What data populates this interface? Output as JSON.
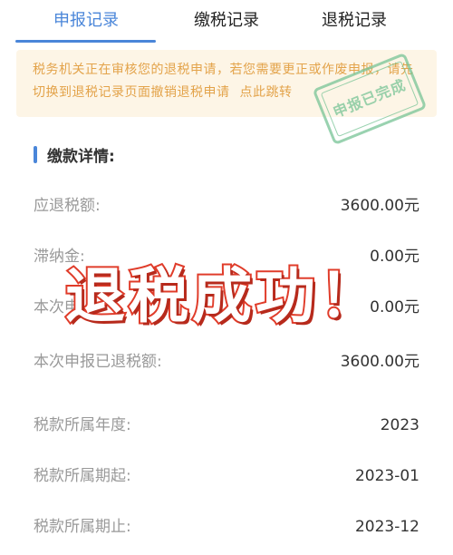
{
  "tabs": [
    {
      "label": "申报记录",
      "active": true
    },
    {
      "label": "缴税记录",
      "active": false
    },
    {
      "label": "退税记录",
      "active": false
    }
  ],
  "notice": {
    "text": "税务机关正在审核您的退税申请，若您需要更正或作废申报，请先切换到退税记录页面撤销退税申请",
    "link": "点此跳转"
  },
  "stamp": {
    "text": "申报已完成"
  },
  "section": {
    "title": "缴款详情:"
  },
  "details": [
    {
      "label": "应退税额:",
      "value": "3600.00元"
    },
    {
      "label": "滞纳金:",
      "value": "0.00元"
    },
    {
      "label": "本次申",
      "value": "0.00元"
    },
    {
      "label": "本次申报已退税额:",
      "value": "3600.00元"
    },
    {
      "label": "税款所属年度:",
      "value": "2023"
    },
    {
      "label": "税款所属期起:",
      "value": "2023-01"
    },
    {
      "label": "税款所属期止:",
      "value": "2023-12"
    }
  ],
  "overlay": {
    "text": "退税成功！"
  },
  "colors": {
    "accent": "#4a86d9",
    "notice_bg": "#fdf5e6",
    "notice_text": "#e3a34a",
    "stamp": "#78c496",
    "overlay_stroke": "#e03c2a"
  }
}
